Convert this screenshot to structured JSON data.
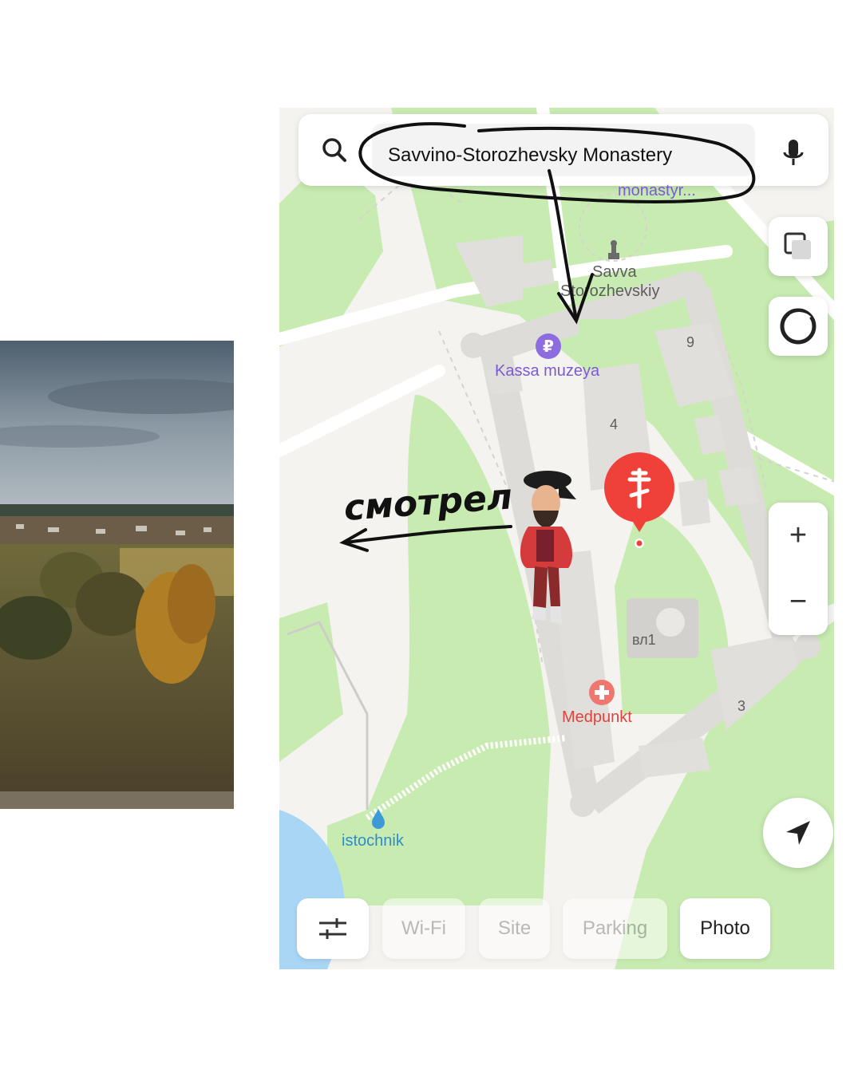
{
  "search": {
    "query": "Savvino-Storozhevsky Monastery"
  },
  "map_labels": {
    "monastyr": "monastyr...",
    "savva_line1": "Savva",
    "savva_line2": "Storozhevskiy",
    "kassa": "Kassa muzeya",
    "building_9": "9",
    "building_4": "4",
    "building_vl1": "вл1",
    "building_3": "3",
    "medpunkt": "Medpunkt",
    "istochnik": "istochnik"
  },
  "zoom": {
    "in": "+",
    "out": "−"
  },
  "chips": [
    {
      "label": "Wi-Fi",
      "state": "inactive"
    },
    {
      "label": "Site",
      "state": "inactive"
    },
    {
      "label": "Parking",
      "state": "inactive"
    },
    {
      "label": "Photo",
      "state": "active"
    }
  ],
  "annotation": {
    "handwritten": "смотрел"
  },
  "colors": {
    "green_area": "#c7ebb1",
    "building": "#e1dfdc",
    "road": "#ffffff",
    "water": "#a9d6f5",
    "marker_red": "#f0403a",
    "ruble_purple": "#8d6ce0"
  },
  "icons": [
    "search-icon",
    "microphone-icon",
    "layers-icon",
    "alice-icon",
    "locate-arrow-icon",
    "filter-icon",
    "ruble-icon",
    "medpunkt-icon",
    "spring-drop-icon",
    "monument-icon",
    "orthodox-cross-icon"
  ]
}
